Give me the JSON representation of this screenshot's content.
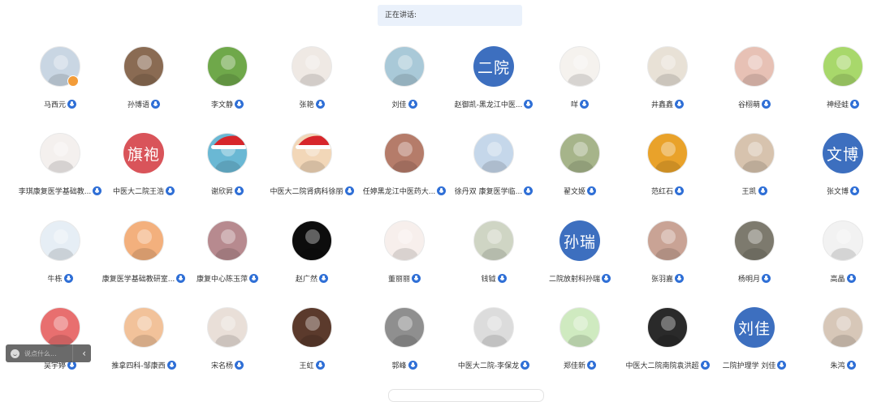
{
  "speaking": {
    "label": "正在讲话:"
  },
  "chat": {
    "placeholder": "说点什么...",
    "collapse_icon": "‹"
  },
  "colors": {
    "mic_badge": "#2f6fd6",
    "host_badge": "#f39c38",
    "text_avatar": "#3d6fbf",
    "speaking_bar": "#eaf1fb"
  },
  "participants": [
    {
      "name": "马西元",
      "bg": "#c9d6e3",
      "host": true
    },
    {
      "name": "孙博语",
      "bg": "#8a6b53"
    },
    {
      "name": "李文静",
      "bg": "#6fa84a"
    },
    {
      "name": "张艳",
      "bg": "#efe9e4"
    },
    {
      "name": "刘佳",
      "bg": "#a9c9d8"
    },
    {
      "name": "赵御凯-黑龙江中医...",
      "avatar_text": "二院",
      "bg": "#3d6fbf"
    },
    {
      "name": "咩",
      "bg": "#f5f2ee"
    },
    {
      "name": "井鑫鑫",
      "bg": "#e8e1d6"
    },
    {
      "name": "谷栩萌",
      "bg": "#e7c1b5"
    },
    {
      "name": "神经蛙",
      "bg": "#a8d86b"
    },
    {
      "name": "李琪康复医学基础教...",
      "bg": "#f4f0ee"
    },
    {
      "name": "中医大二院王浩",
      "avatar_text": "旗袍",
      "bg": "#d9545a"
    },
    {
      "name": "谢欣昇",
      "bg": "#6ab8d4",
      "santa": true
    },
    {
      "name": "中医大二院肾病科徐丽",
      "bg": "#f2d7b8",
      "santa": true
    },
    {
      "name": "任婷黑龙江中医药大...",
      "bg": "#b57c6a"
    },
    {
      "name": "徐丹双 康复医学临...",
      "bg": "#c5d7ea"
    },
    {
      "name": "翟文姬",
      "bg": "#a6b48a"
    },
    {
      "name": "范红石",
      "bg": "#e9a22a"
    },
    {
      "name": "王凯",
      "bg": "#d7c3ae"
    },
    {
      "name": "张文博",
      "avatar_text": "文博",
      "bg": "#3d6fbf"
    },
    {
      "name": "牛栋",
      "bg": "#e6eef5"
    },
    {
      "name": "康复医学基础教研室...",
      "bg": "#f3b07d"
    },
    {
      "name": "康复中心陈玉萍",
      "bg": "#b78a8f"
    },
    {
      "name": "赵广然",
      "bg": "#0d0d0d"
    },
    {
      "name": "董丽丽",
      "bg": "#f7efec"
    },
    {
      "name": "钱钺",
      "bg": "#cfd5c4"
    },
    {
      "name": "二院放射科孙瑞",
      "avatar_text": "孙瑞",
      "bg": "#3d6fbf"
    },
    {
      "name": "张羽嘉",
      "bg": "#c9a395"
    },
    {
      "name": "杨明月",
      "bg": "#7d7a6e"
    },
    {
      "name": "高晶",
      "bg": "#f2f2f2"
    },
    {
      "name": "吴宇婷",
      "bg": "#e86f6f"
    },
    {
      "name": "推拿四科-邹康西",
      "bg": "#f2c29a"
    },
    {
      "name": "宋名杨",
      "bg": "#e9dfd8"
    },
    {
      "name": "王虹",
      "bg": "#5b3a2c"
    },
    {
      "name": "郭峰",
      "bg": "#8f8f8f"
    },
    {
      "name": "中医大二院-李保龙",
      "bg": "#dcdcdc"
    },
    {
      "name": "郑佳新",
      "bg": "#cfeac0"
    },
    {
      "name": "中医大二院南院袁洪超",
      "bg": "#2a2a2a"
    },
    {
      "name": "二院护理学 刘佳",
      "avatar_text": "刘佳",
      "bg": "#3d6fbf"
    },
    {
      "name": "朱鸿",
      "bg": "#d7c7b8"
    }
  ]
}
